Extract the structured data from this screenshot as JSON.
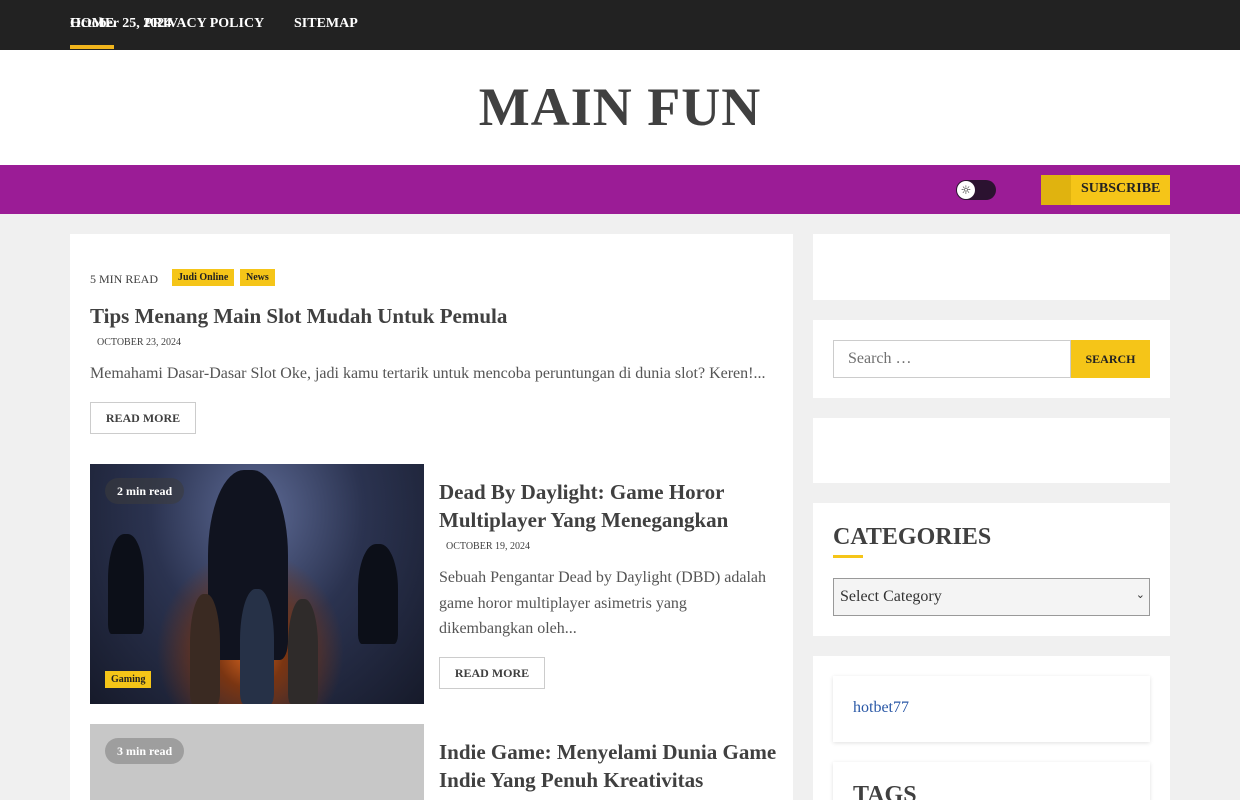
{
  "topbar": {
    "date": "October 25, 2024"
  },
  "header": {
    "site_title": "MAIN FUN"
  },
  "nav": {
    "items": [
      {
        "label": "Home",
        "active": true
      },
      {
        "label": "Privacy Policy",
        "active": false
      },
      {
        "label": "Sitemap",
        "active": false
      }
    ],
    "theme_toggle_icon": "sun-icon",
    "subscribe_label": "Subscribe"
  },
  "posts": [
    {
      "read_time": "5 MIN READ",
      "categories": [
        "Judi Online",
        "News"
      ],
      "title": "Tips Menang Main Slot Mudah Untuk Pemula",
      "date": "OCTOBER 23, 2024",
      "excerpt": "Memahami Dasar-Dasar Slot Oke, jadi kamu tertarik untuk mencoba peruntungan di dunia slot? Keren!...",
      "read_more": "Read More"
    },
    {
      "read_time": "2 min read",
      "categories": [
        "Gaming"
      ],
      "title": "Dead By Daylight: Game Horor Multiplayer Yang Menegangkan",
      "date": "OCTOBER 19, 2024",
      "excerpt": "Sebuah Pengantar Dead by Daylight (DBD) adalah game horor multiplayer asimetris yang dikembangkan oleh...",
      "read_more": "Read More"
    },
    {
      "read_time": "3 min read",
      "title": "Indie Game: Menyelami Dunia Game Indie Yang Penuh Kreativitas"
    }
  ],
  "sidebar": {
    "search": {
      "placeholder": "Search …",
      "button": "Search"
    },
    "categories": {
      "title": "Categories",
      "select_value": "Select Category"
    },
    "links": {
      "item": "hotbet77"
    },
    "tags": {
      "title": "Tags"
    }
  },
  "colors": {
    "nav_bg": "#9b1c96",
    "accent": "#f5c518",
    "topbar_bg": "#222222"
  }
}
